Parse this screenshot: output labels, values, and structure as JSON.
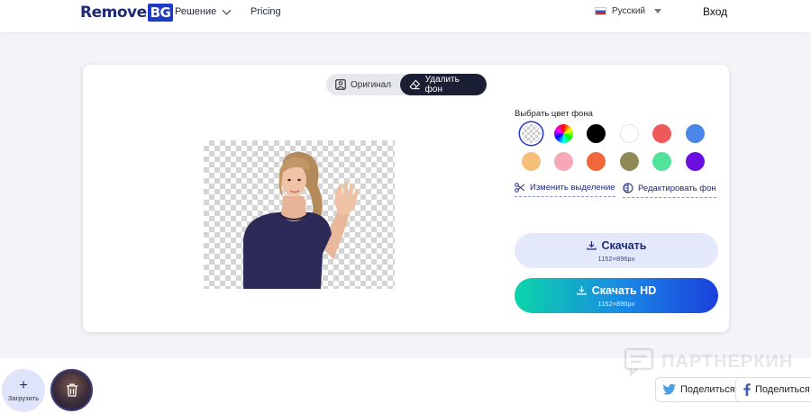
{
  "header": {
    "logo_main": "Remove",
    "logo_accent": "BG",
    "nav_solution": "Решение",
    "nav_pricing": "Pricing",
    "language": "Русский",
    "login": "Вход"
  },
  "editor": {
    "tab_original": "Оригинал",
    "tab_remove_bg": "Удалить фон",
    "color_title": "Выбрать цвет фона",
    "swatches": [
      "transparent",
      "rainbow",
      "#000000",
      "#ffffff",
      "#ee5a5a",
      "#4a86e8",
      "#f7c07a",
      "#f7a8b8",
      "#f0683a",
      "#8f8a55",
      "#52e39a",
      "#6a0fe0"
    ],
    "edit_selection": "Изменить выделение",
    "edit_background": "Редактировать фон",
    "download_label": "Скачать",
    "download_size": "1152×896px",
    "download_hd_label": "Скачать HD",
    "download_hd_size": "1152×896px"
  },
  "bottom": {
    "upload_label": "Загрузить",
    "watermark": "ПАРТНЕРКИН",
    "share_twitter": "Поделиться",
    "share_facebook": "Поделиться"
  },
  "colors": {
    "brand": "#1e2a78",
    "accent": "#1e3ac7"
  }
}
